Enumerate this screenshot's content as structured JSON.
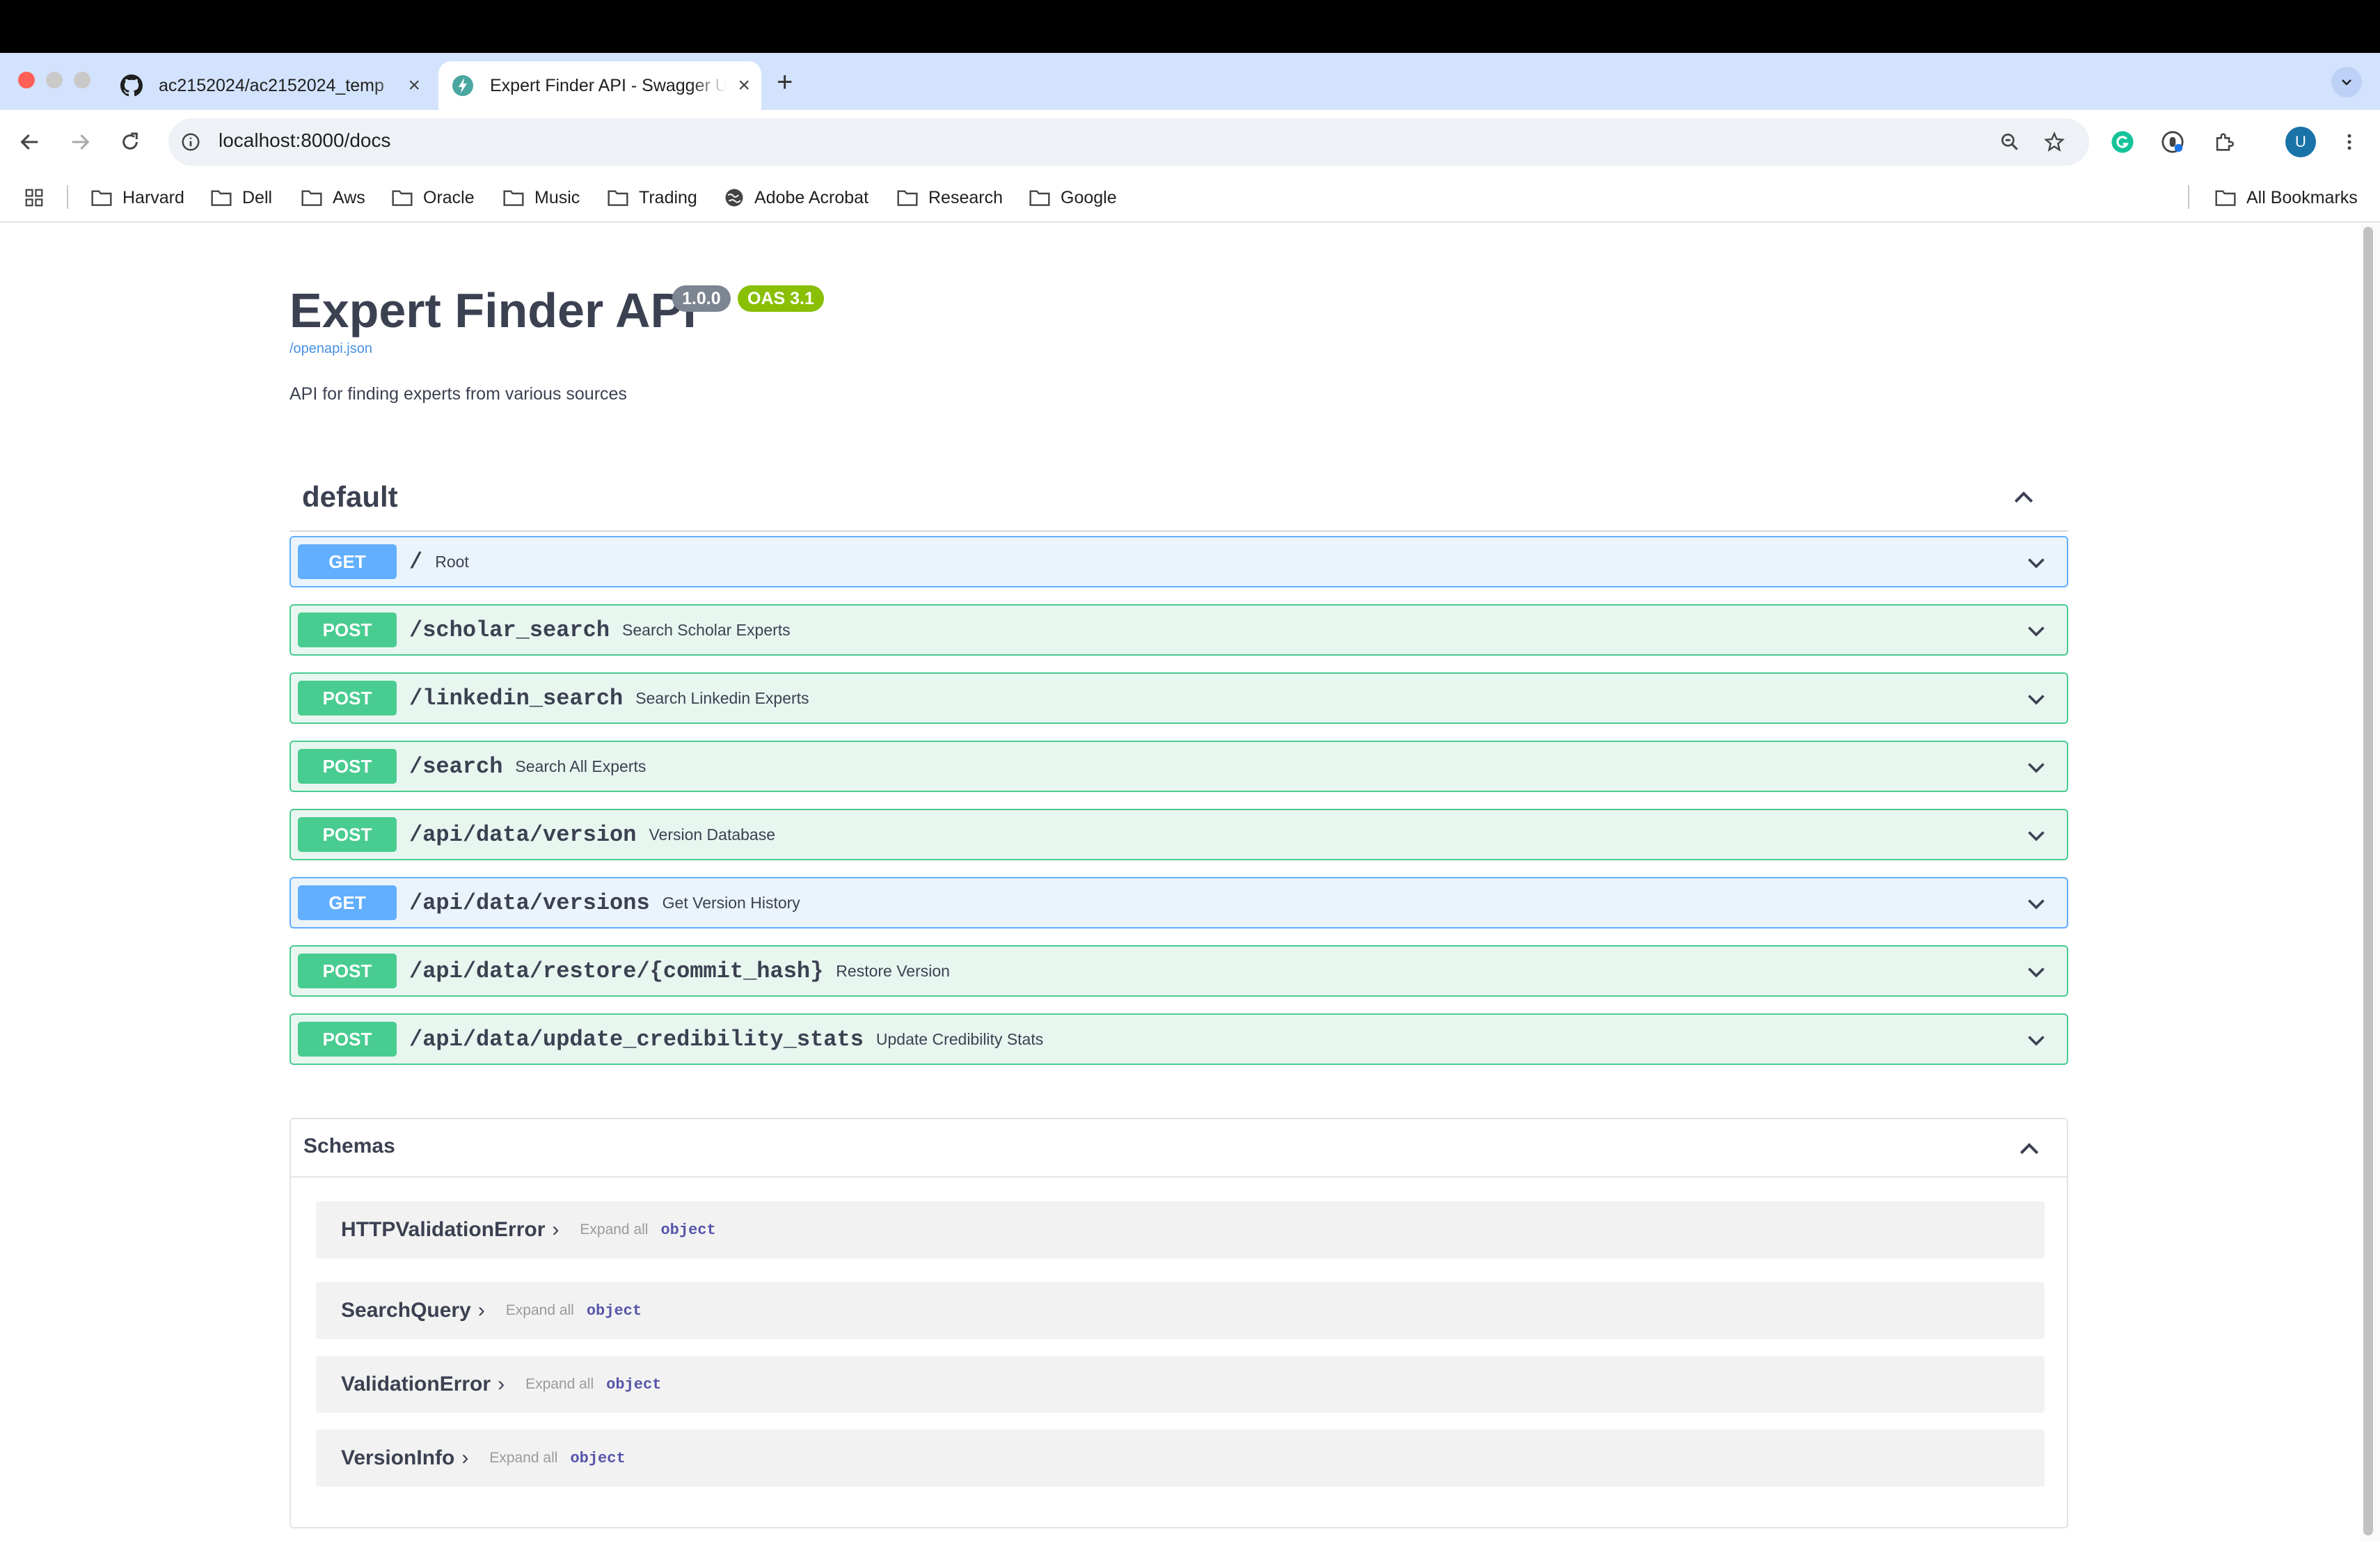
{
  "browser": {
    "tabs": [
      {
        "title": "ac2152024/ac2152024_temp",
        "icon": "github-icon",
        "active": false
      },
      {
        "title": "Expert Finder API - Swagger UI",
        "icon": "swagger-icon",
        "active": true
      }
    ],
    "new_tab_label": "+",
    "url": "localhost:8000/docs",
    "avatar_letter": "U",
    "bookmarks": [
      "Harvard",
      "Dell",
      "Aws",
      "Oracle",
      "Music",
      "Trading",
      "Adobe Acrobat",
      "Research",
      "Google"
    ],
    "all_bookmarks_label": "All Bookmarks"
  },
  "api": {
    "title": "Expert Finder API",
    "version": "1.0.0",
    "oas_version": "OAS 3.1",
    "spec_link": "/openapi.json",
    "description": "API for finding experts from various sources"
  },
  "tag": {
    "name": "default",
    "operations": [
      {
        "method": "GET",
        "path": "/",
        "summary": "Root"
      },
      {
        "method": "POST",
        "path": "/scholar_search",
        "summary": "Search Scholar Experts"
      },
      {
        "method": "POST",
        "path": "/linkedin_search",
        "summary": "Search Linkedin Experts"
      },
      {
        "method": "POST",
        "path": "/search",
        "summary": "Search All Experts"
      },
      {
        "method": "POST",
        "path": "/api/data/version",
        "summary": "Version Database"
      },
      {
        "method": "GET",
        "path": "/api/data/versions",
        "summary": "Get Version History"
      },
      {
        "method": "POST",
        "path": "/api/data/restore/{commit_hash}",
        "summary": "Restore Version"
      },
      {
        "method": "POST",
        "path": "/api/data/update_credibility_stats",
        "summary": "Update Credibility Stats"
      }
    ]
  },
  "schemas": {
    "title": "Schemas",
    "expand_all_label": "Expand all",
    "models": [
      {
        "name": "HTTPValidationError",
        "type": "object"
      },
      {
        "name": "SearchQuery",
        "type": "object"
      },
      {
        "name": "ValidationError",
        "type": "object"
      },
      {
        "name": "VersionInfo",
        "type": "object"
      }
    ]
  },
  "colors": {
    "get": "#61affe",
    "post": "#49cc90",
    "version_badge": "#7d8492",
    "oas_badge": "#89bf04"
  }
}
